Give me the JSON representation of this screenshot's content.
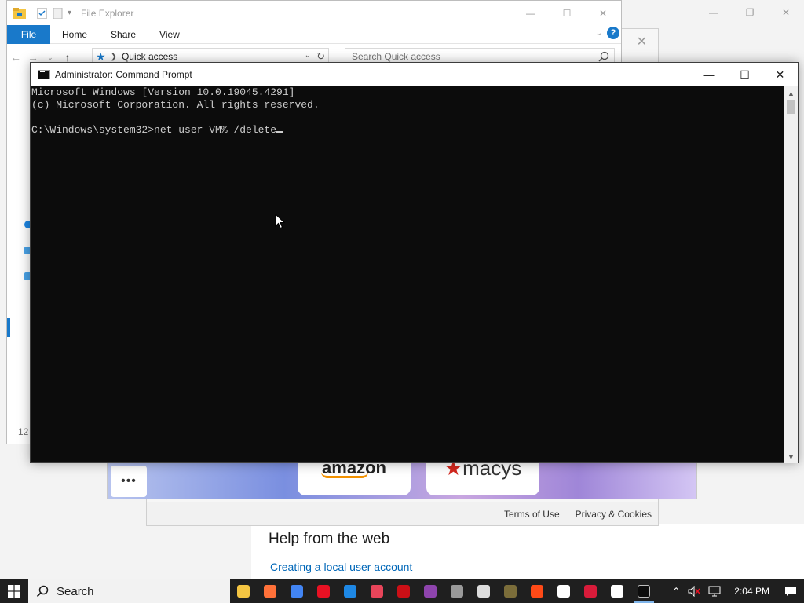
{
  "settings": {
    "help_title": "Help from the web",
    "help_link": "Creating a local user account"
  },
  "browser": {
    "footer": {
      "terms": "Terms of Use",
      "privacy": "Privacy & Cookies"
    },
    "tiles": {
      "more_glyph": "•••",
      "amazon_text": "amazon",
      "second_text": "macys"
    }
  },
  "explorer": {
    "title": "File Explorer",
    "ribbon": {
      "file": "File",
      "home": "Home",
      "share": "Share",
      "view": "View"
    },
    "address": {
      "location": "Quick access"
    },
    "search": {
      "placeholder": "Search Quick access"
    },
    "status": "12"
  },
  "cmd": {
    "title": "Administrator: Command Prompt",
    "lines": [
      "Microsoft Windows [Version 10.0.19045.4291]",
      "(c) Microsoft Corporation. All rights reserved.",
      "",
      "C:\\Windows\\system32>net user VM% /delete"
    ]
  },
  "taskbar": {
    "search_label": "Search",
    "clock": "2:04 PM",
    "apps": [
      {
        "name": "file-explorer",
        "color": "#f4c542"
      },
      {
        "name": "firefox",
        "color": "#ff7139"
      },
      {
        "name": "chrome",
        "color": "#4285f4"
      },
      {
        "name": "red-app",
        "color": "#e81123"
      },
      {
        "name": "shield-app",
        "color": "#1e88e5"
      },
      {
        "name": "camera-app",
        "color": "#e8455a"
      },
      {
        "name": "opera",
        "color": "#cc0f16"
      },
      {
        "name": "game-app",
        "color": "#8e44ad"
      },
      {
        "name": "tank-app",
        "color": "#9a9a9a"
      },
      {
        "name": "steam-like-app",
        "color": "#dcdcdc"
      },
      {
        "name": "minecraft-app",
        "color": "#7b6d3a"
      },
      {
        "name": "orange-app",
        "color": "#ff4a17"
      },
      {
        "name": "settings-app",
        "color": "#ffffff"
      },
      {
        "name": "media-app",
        "color": "#d81b3a"
      },
      {
        "name": "yandex-app",
        "color": "#ffffff"
      },
      {
        "name": "command-prompt",
        "color": "#0c0c0c"
      }
    ]
  },
  "colors": {
    "accent": "#1979ca",
    "cmd_bg": "#0c0c0c",
    "cmd_text": "#cccccc",
    "taskbar": "#1f1f1f"
  }
}
